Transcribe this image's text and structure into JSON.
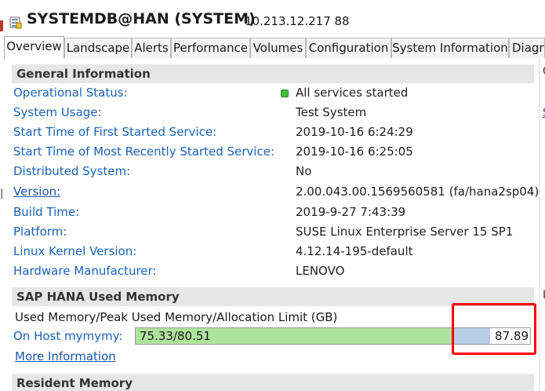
{
  "window": {
    "title": "SYSTEMDB@HAN (SYSTEM)",
    "host": "10.213.12.217 88"
  },
  "tabs": [
    {
      "label": "Overview",
      "active": true
    },
    {
      "label": "Landscape",
      "active": false
    },
    {
      "label": "Alerts",
      "active": false
    },
    {
      "label": "Performance",
      "active": false
    },
    {
      "label": "Volumes",
      "active": false
    },
    {
      "label": "Configuration",
      "active": false
    },
    {
      "label": "System Information",
      "active": false
    },
    {
      "label": "Diagn",
      "active": false
    }
  ],
  "general": {
    "header": "General Information",
    "rows": [
      {
        "label": "Operational Status:",
        "value": "All services started",
        "status_color": "#3fbf3f"
      },
      {
        "label": "System Usage:",
        "value": "Test System"
      },
      {
        "label": "Start Time of First Started Service:",
        "value": "2019-10-16 6:24:29"
      },
      {
        "label": "Start Time of Most Recently Started Service:",
        "value": "2019-10-16 6:25:05"
      },
      {
        "label": "Distributed System:",
        "value": "No"
      },
      {
        "label": "Version:",
        "value": "2.00.043.00.1569560581 (fa/hana2sp04)",
        "link": true
      },
      {
        "label": "Build Time:",
        "value": "2019-9-27 7:43:39"
      },
      {
        "label": "Platform:",
        "value": "SUSE Linux Enterprise Server 15 SP1"
      },
      {
        "label": "Linux Kernel Version:",
        "value": "4.12.14-195-default"
      },
      {
        "label": "Hardware Manufacturer:",
        "value": "LENOVO"
      }
    ]
  },
  "memory": {
    "header": "SAP HANA Used Memory",
    "caption": "Used Memory/Peak Used Memory/Allocation Limit (GB)",
    "host_label": "On Host mymymy:",
    "used_peak_text": "75.33/80.51",
    "limit_text": "87.89",
    "used_gb": 75.33,
    "peak_gb": 80.51,
    "limit_gb": 87.89,
    "used_color": "#aee39d",
    "peak_color": "#b7cde6",
    "more_info": "More Information"
  },
  "resident": {
    "header": "Resident Memory"
  },
  "annotation": {
    "highlight_color": "#ff0000"
  }
}
